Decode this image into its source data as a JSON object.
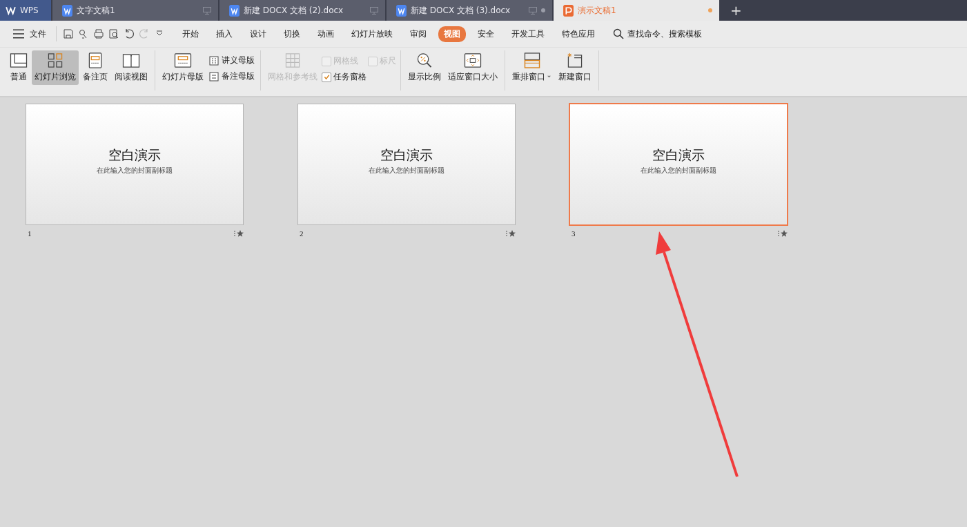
{
  "tabs": [
    {
      "kind": "home",
      "label": "WPS",
      "selected": false
    },
    {
      "kind": "writer",
      "label": "文字文稿1",
      "selected": false,
      "modified": false
    },
    {
      "kind": "writer",
      "label": "新建 DOCX 文档 (2).docx",
      "selected": false,
      "modified": false
    },
    {
      "kind": "writer",
      "label": "新建 DOCX 文档 (3).docx",
      "selected": false,
      "modified": true
    },
    {
      "kind": "presentation",
      "label": "演示文稿1",
      "selected": true,
      "modified": true
    }
  ],
  "new_tab": "+",
  "menu": {
    "file": "文件",
    "items": [
      {
        "label": "开始",
        "selected": false
      },
      {
        "label": "插入",
        "selected": false
      },
      {
        "label": "设计",
        "selected": false
      },
      {
        "label": "切换",
        "selected": false
      },
      {
        "label": "动画",
        "selected": false
      },
      {
        "label": "幻灯片放映",
        "selected": false
      },
      {
        "label": "审阅",
        "selected": false
      },
      {
        "label": "视图",
        "selected": true
      },
      {
        "label": "安全",
        "selected": false
      },
      {
        "label": "开发工具",
        "selected": false
      },
      {
        "label": "特色应用",
        "selected": false
      }
    ],
    "search": "查找命令、搜索模板"
  },
  "ribbon": [
    [
      {
        "kind": "big",
        "label": "普通",
        "selected": false
      },
      {
        "kind": "big",
        "label": "幻灯片浏览",
        "selected": true
      },
      {
        "kind": "big",
        "label": "备注页",
        "selected": false
      },
      {
        "kind": "big",
        "label": "阅读视图",
        "selected": false
      }
    ],
    [
      {
        "kind": "big",
        "label": "幻灯片母版",
        "selected": false
      },
      {
        "kind": "stack",
        "items": [
          {
            "label": "讲义母版"
          },
          {
            "label": "备注母版"
          }
        ]
      }
    ],
    [
      {
        "kind": "big",
        "label": "网格和参考线",
        "selected": false,
        "disabled": true
      },
      {
        "kind": "checks",
        "items": [
          [
            {
              "label": "网格线",
              "checked": false,
              "disabled": true
            },
            {
              "label": "标尺",
              "checked": false,
              "disabled": true
            }
          ],
          [
            {
              "label": "任务窗格",
              "checked": true,
              "disabled": false
            }
          ]
        ]
      }
    ],
    [
      {
        "kind": "big",
        "label": "显示比例",
        "selected": false
      },
      {
        "kind": "big",
        "label": "适应窗口大小",
        "selected": false
      }
    ],
    [
      {
        "kind": "big",
        "label": "重排窗口",
        "selected": false,
        "dropdown": true
      },
      {
        "kind": "big",
        "label": "新建窗口",
        "selected": false
      }
    ]
  ],
  "slides": [
    {
      "number": "1",
      "title": "空白演示",
      "subtitle": "在此输入您的封面副标题",
      "selected": false
    },
    {
      "number": "2",
      "title": "空白演示",
      "subtitle": "在此输入您的封面副标题",
      "selected": false
    },
    {
      "number": "3",
      "title": "空白演示",
      "subtitle": "在此输入您的封面副标题",
      "selected": true
    }
  ],
  "annotation": {
    "kind": "arrow",
    "color": "#f03c3c"
  }
}
